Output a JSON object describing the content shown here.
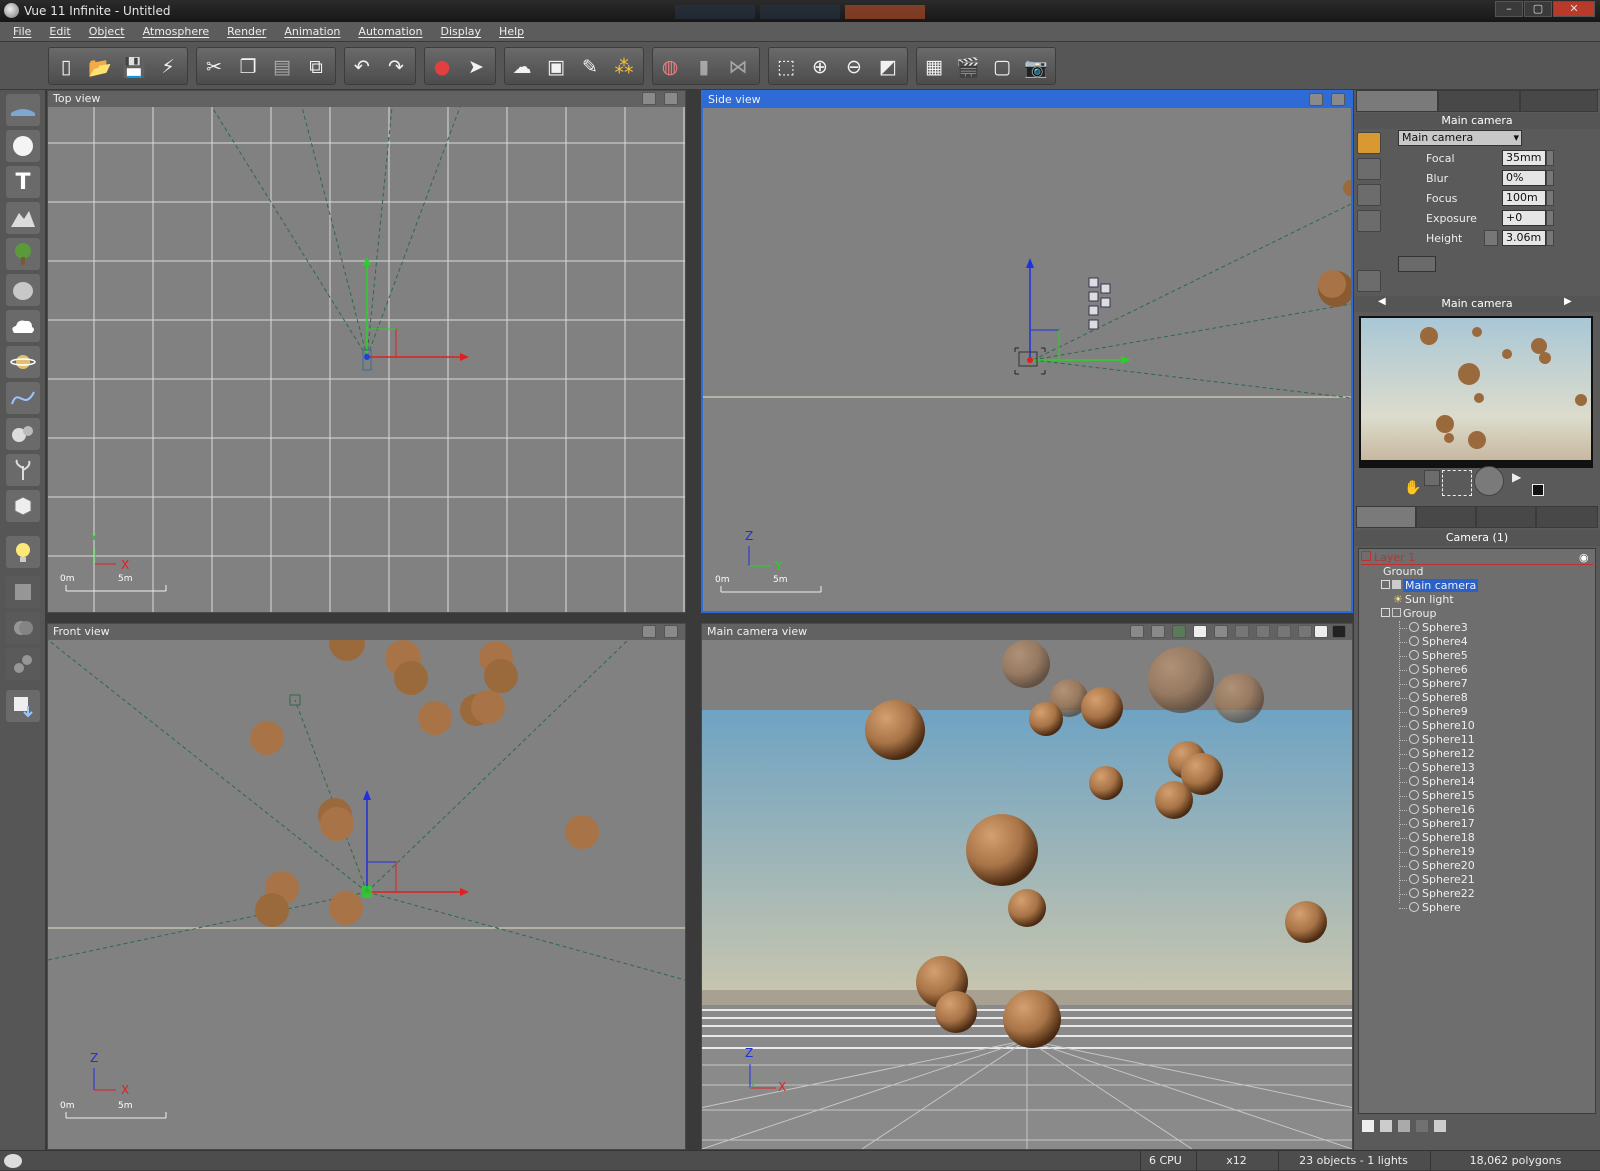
{
  "window": {
    "title": "Vue 11 Infinite - Untitled",
    "controls": [
      "–",
      "▢",
      "✕"
    ]
  },
  "menu": {
    "items": [
      "File",
      "Edit",
      "Object",
      "Atmosphere",
      "Render",
      "Animation",
      "Automation",
      "Display",
      "Help"
    ]
  },
  "viewports": {
    "top": {
      "title": "Top view",
      "axes": {
        "a": "Y",
        "b": "X"
      },
      "scale": [
        "0m",
        "5m"
      ]
    },
    "side": {
      "title": "Side view",
      "axes": {
        "a": "Z",
        "b": "Y"
      },
      "scale": [
        "0m",
        "5m"
      ]
    },
    "front": {
      "title": "Front view",
      "axes": {
        "a": "Z",
        "b": "X"
      },
      "scale": [
        "0m",
        "5m"
      ]
    },
    "camera": {
      "title": "Main camera view",
      "axes": {
        "a": "Z",
        "b": "X"
      }
    }
  },
  "camera_panel": {
    "title": "Main camera",
    "selector": "Main camera",
    "props": [
      {
        "label": "Focal",
        "value": "35mm"
      },
      {
        "label": "Blur",
        "value": "0%"
      },
      {
        "label": "Focus",
        "value": "100m"
      },
      {
        "label": "Exposure",
        "value": "+0"
      },
      {
        "label": "Height",
        "value": "3.06m"
      }
    ],
    "preview_title": "Main camera"
  },
  "world_browser": {
    "title": "Camera (1)",
    "layer": "Layer 1",
    "items": [
      "Ground",
      "Main camera",
      "Sun light",
      "Group"
    ],
    "spheres": [
      "Sphere3",
      "Sphere4",
      "Sphere5",
      "Sphere6",
      "Sphere7",
      "Sphere8",
      "Sphere9",
      "Sphere10",
      "Sphere11",
      "Sphere12",
      "Sphere13",
      "Sphere14",
      "Sphere15",
      "Sphere16",
      "Sphere17",
      "Sphere18",
      "Sphere19",
      "Sphere20",
      "Sphere21",
      "Sphere22",
      "Sphere"
    ]
  },
  "status": {
    "cpu": "6 CPU",
    "zoom": "x12",
    "objects": "23 objects - 1 lights",
    "polygons": "18,062 polygons"
  },
  "colors": {
    "accent": "#2f6bd6",
    "sphere": "#a87447",
    "viewport_bg": "#818181",
    "selection": "#2a60c8"
  }
}
